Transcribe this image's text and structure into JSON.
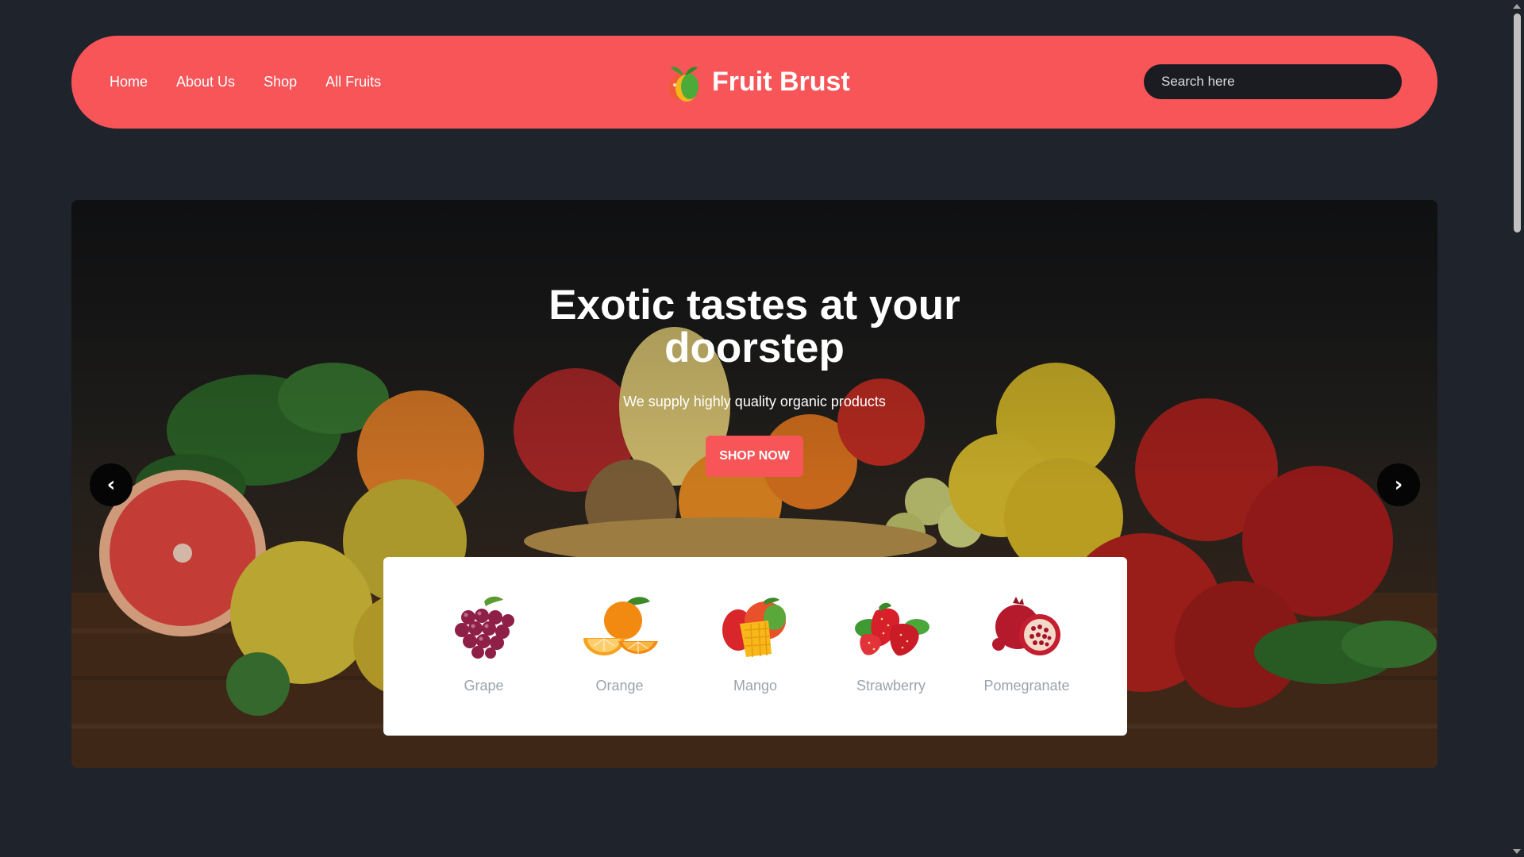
{
  "header": {
    "nav": [
      {
        "label": "Home"
      },
      {
        "label": "About Us"
      },
      {
        "label": "Shop"
      },
      {
        "label": "All Fruits"
      }
    ],
    "brand": "Fruit Brust",
    "search_placeholder": "Search here",
    "background_color": "#f85559"
  },
  "hero": {
    "title_line1": "Exotic tastes at your",
    "title_line2": "doorstep",
    "subtitle": "We supply highly quality organic products",
    "cta": "SHOP NOW",
    "prev_arrow": "‹",
    "next_arrow": "›"
  },
  "fruits": [
    {
      "name": "Grape",
      "icon": "grape-icon"
    },
    {
      "name": "Orange",
      "icon": "orange-icon"
    },
    {
      "name": "Mango",
      "icon": "mango-icon"
    },
    {
      "name": "Strawberry",
      "icon": "strawberry-icon"
    },
    {
      "name": "Pomegranate",
      "icon": "pomegranate-icon"
    }
  ],
  "colors": {
    "page_background": "#1f232c",
    "accent": "#f85559",
    "fruit_label": "#9aa3ab"
  }
}
